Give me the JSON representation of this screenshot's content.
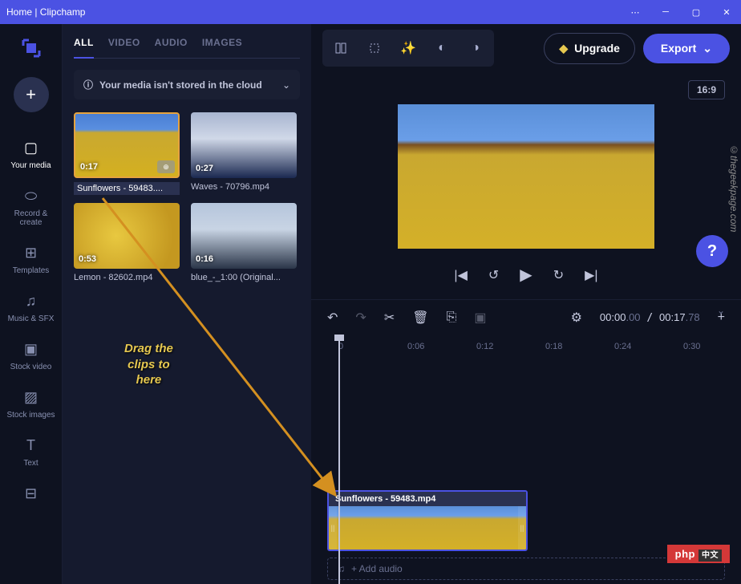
{
  "titlebar": {
    "title": "Home | Clipchamp"
  },
  "sidebar": {
    "items": [
      {
        "icon": "folder-icon",
        "label": "Your media"
      },
      {
        "icon": "record-icon",
        "label": "Record & create"
      },
      {
        "icon": "templates-icon",
        "label": "Templates"
      },
      {
        "icon": "music-icon",
        "label": "Music & SFX"
      },
      {
        "icon": "stock-video-icon",
        "label": "Stock video"
      },
      {
        "icon": "stock-images-icon",
        "label": "Stock images"
      },
      {
        "icon": "text-icon",
        "label": "Text"
      }
    ]
  },
  "tabs": {
    "items": [
      "ALL",
      "VIDEO",
      "AUDIO",
      "IMAGES"
    ],
    "active": 0
  },
  "cloud_notice": "Your media isn't stored in the cloud",
  "media": [
    {
      "name": "Sunflowers - 59483....",
      "duration": "0:17",
      "type": "sunflowers"
    },
    {
      "name": "Waves - 70796.mp4",
      "duration": "0:27",
      "type": "waves"
    },
    {
      "name": "Lemon - 82602.mp4",
      "duration": "0:53",
      "type": "lemon"
    },
    {
      "name": "blue_-_1:00 (Original...",
      "duration": "0:16",
      "type": "blue"
    }
  ],
  "toolbar": {
    "upgrade": "Upgrade",
    "export": "Export"
  },
  "preview": {
    "aspect": "16:9"
  },
  "timecode": {
    "current": "00:00",
    "current_frac": ".00",
    "total": "00:17",
    "total_frac": ".78"
  },
  "ruler": [
    "0",
    "0:06",
    "0:12",
    "0:18",
    "0:24",
    "0:30"
  ],
  "clip": {
    "title": "Sunflowers - 59483.mp4"
  },
  "track_placeholder_audio": "+ Add audio",
  "drag_hint": {
    "l1": "Drag the",
    "l2": "clips to",
    "l3": "here"
  },
  "watermark": "©thegeekpage.com",
  "php_badge": "php"
}
